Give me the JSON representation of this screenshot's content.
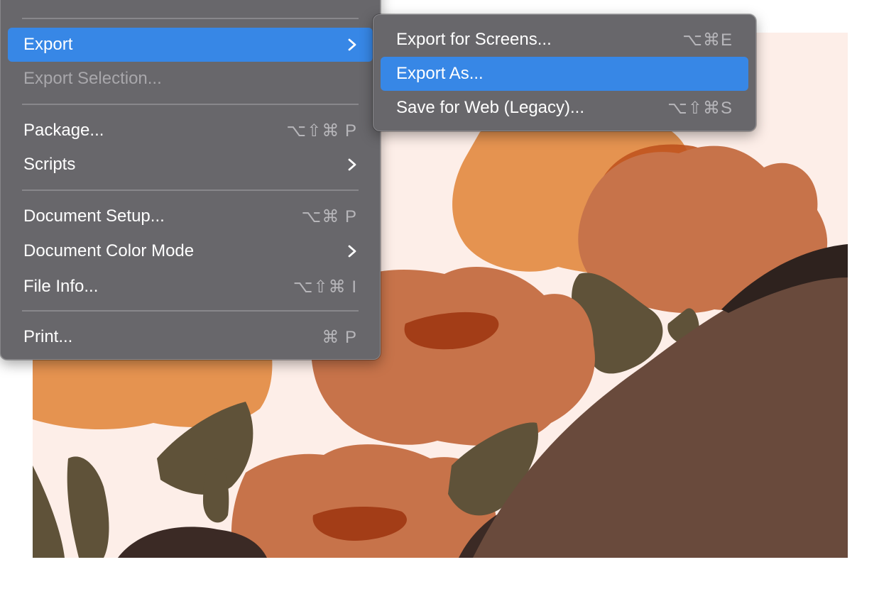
{
  "colors": {
    "menu_bg": "#68676b",
    "highlight": "#3787e6",
    "disabled_text": "#a8a7ab",
    "shortcut_text": "#b7b6ba",
    "artboard_bg": "#fdeee8"
  },
  "file_menu": {
    "items": [
      {
        "label": "Export",
        "submenu": true,
        "selected": true
      },
      {
        "label": "Export Selection...",
        "disabled": true
      },
      {
        "label": "Package...",
        "shortcut": "⌥⇧⌘ P"
      },
      {
        "label": "Scripts",
        "submenu": true
      },
      {
        "label": "Document Setup...",
        "shortcut": "⌥⌘ P"
      },
      {
        "label": "Document Color Mode",
        "submenu": true
      },
      {
        "label": "File Info...",
        "shortcut": "⌥⇧⌘ I"
      },
      {
        "label": "Print...",
        "shortcut": "⌘ P"
      }
    ]
  },
  "export_submenu": {
    "items": [
      {
        "label": "Export for Screens...",
        "shortcut": "⌥⌘E"
      },
      {
        "label": "Export As...",
        "selected": true
      },
      {
        "label": "Save for Web (Legacy)...",
        "shortcut": "⌥⇧⌘S"
      }
    ]
  },
  "icons": {
    "submenu_arrow": "chevron-right-icon"
  }
}
